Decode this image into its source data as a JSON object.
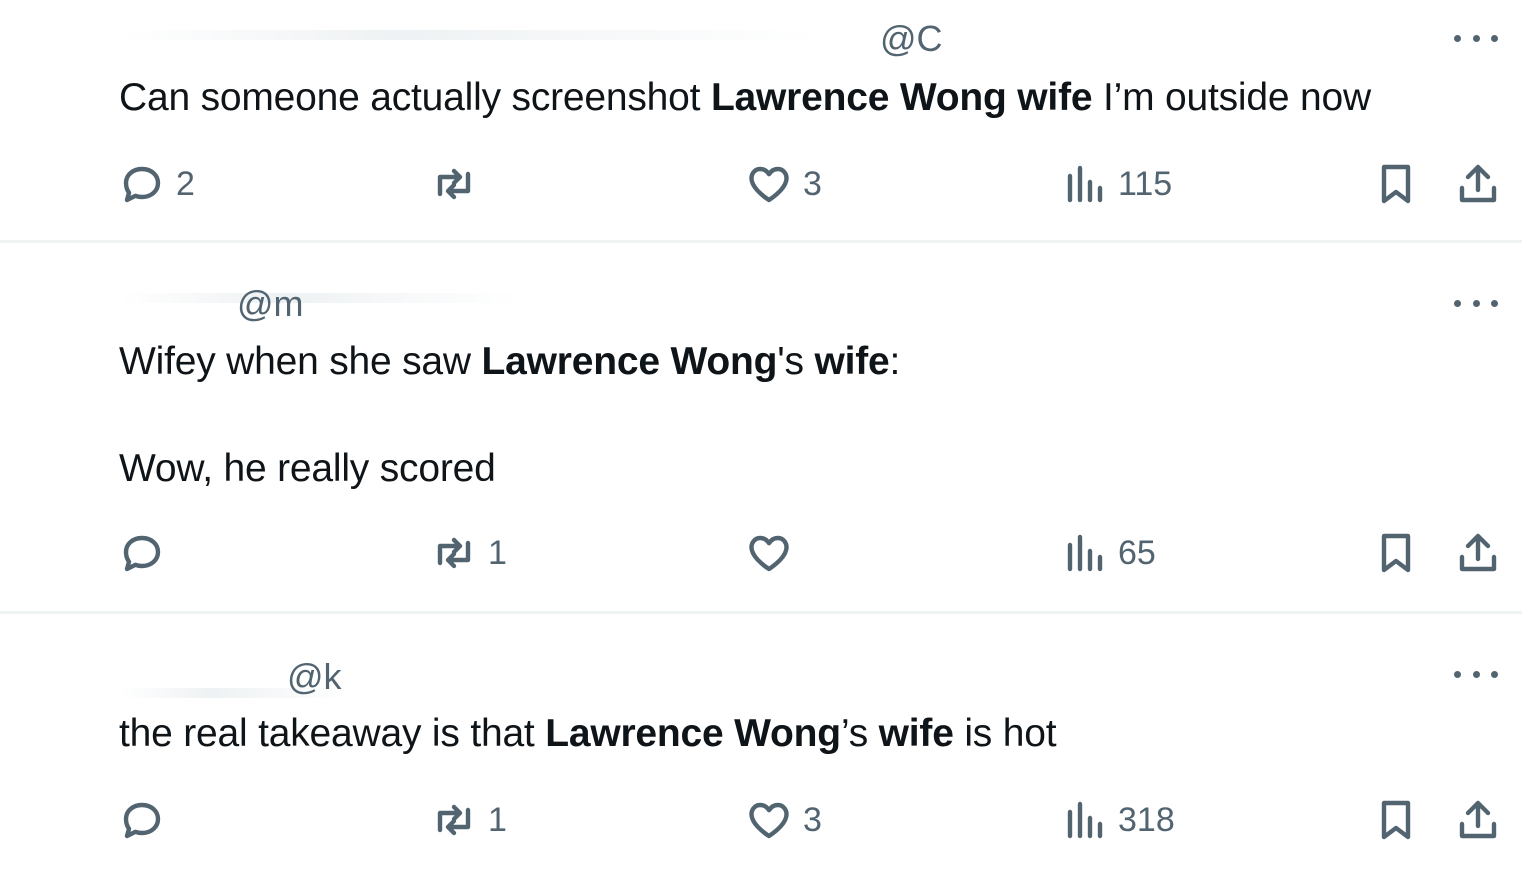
{
  "posts": [
    {
      "handle": "@C",
      "segments": [
        {
          "t": "Can someone actually screenshot ",
          "b": false
        },
        {
          "t": "Lawrence Wong wife",
          "b": true
        },
        {
          "t": " I’m outside now",
          "b": false
        }
      ],
      "replies": "2",
      "reposts": "",
      "likes": "3",
      "views": "115"
    },
    {
      "handle": "@m",
      "segments_line1": [
        {
          "t": "Wifey when she saw ",
          "b": false
        },
        {
          "t": "Lawrence Wong",
          "b": true
        },
        {
          "t": "'s ",
          "b": false
        },
        {
          "t": "wife",
          "b": true
        },
        {
          "t": ":",
          "b": false
        }
      ],
      "line2": "Wow, he really scored",
      "replies": "",
      "reposts": "1",
      "likes": "",
      "views": "65"
    },
    {
      "handle": "@k",
      "segments": [
        {
          "t": "the real takeaway is that ",
          "b": false
        },
        {
          "t": "Lawrence Wong",
          "b": true
        },
        {
          "t": "’s ",
          "b": false
        },
        {
          "t": "wife",
          "b": true
        },
        {
          "t": " is hot",
          "b": false
        }
      ],
      "replies": "",
      "reposts": "1",
      "likes": "3",
      "views": "318"
    }
  ],
  "icons": {
    "reply": "reply-icon",
    "repost": "repost-icon",
    "like": "heart-icon",
    "views": "views-chart-icon",
    "bookmark": "bookmark-icon",
    "share": "share-icon",
    "more": "more-dots-icon"
  },
  "colors": {
    "text": "#0f1419",
    "muted": "#536471",
    "divider": "#eff3f4",
    "background": "#ffffff"
  }
}
